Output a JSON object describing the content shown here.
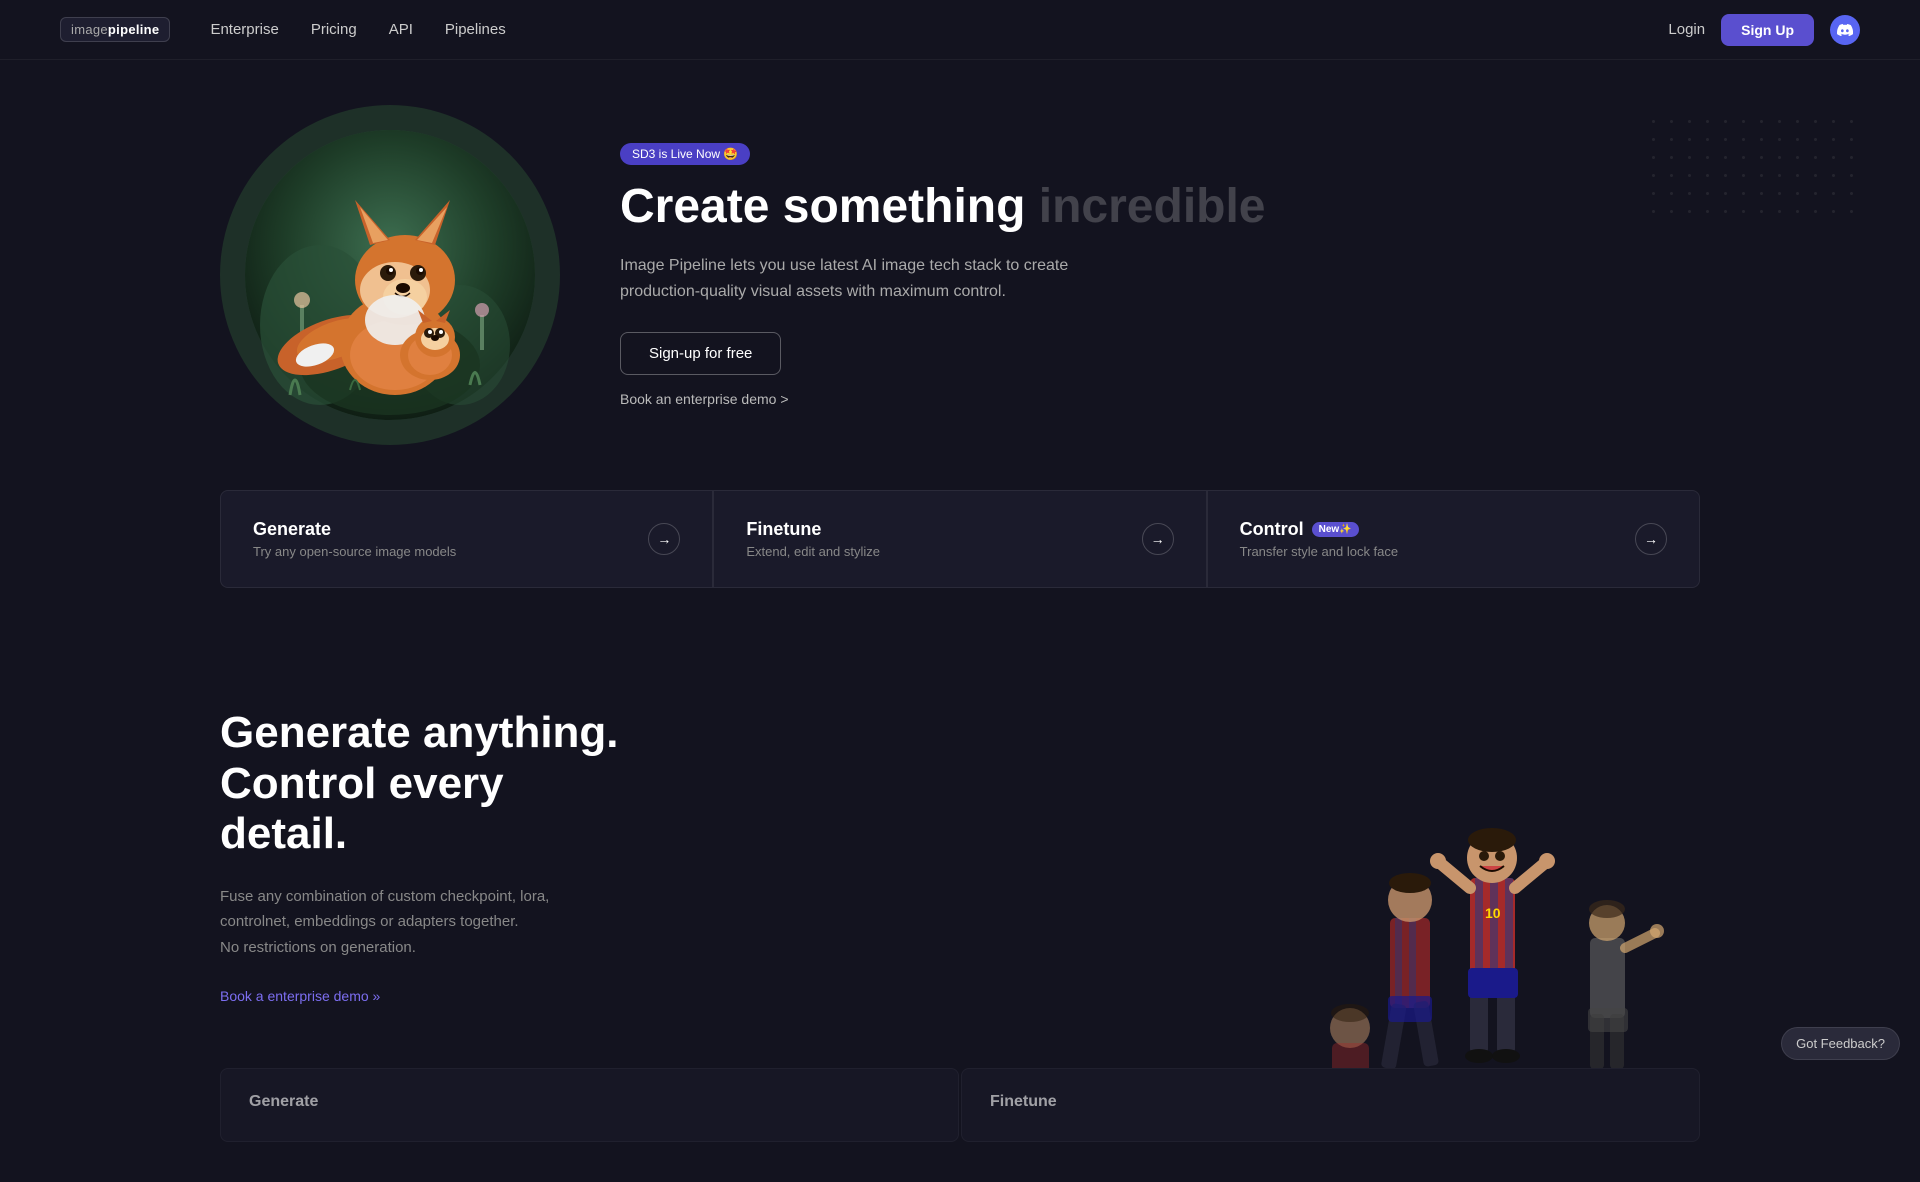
{
  "nav": {
    "logo_text": "image",
    "logo_bold": "pipeline",
    "links": [
      {
        "label": "Enterprise",
        "href": "#"
      },
      {
        "label": "Pricing",
        "href": "#"
      },
      {
        "label": "API",
        "href": "#"
      },
      {
        "label": "Pipelines",
        "href": "#"
      }
    ],
    "login_label": "Login",
    "signup_label": "Sign Up"
  },
  "hero": {
    "badge_text": "SD3 is Live Now 🤩",
    "title_main": "Create something",
    "title_faded": "incredible",
    "subtitle": "Image Pipeline lets you use latest AI image tech stack to create production-quality visual assets with maximum control.",
    "cta_primary": "Sign-up for free",
    "cta_secondary": "Book an enterprise demo >"
  },
  "feature_cards": [
    {
      "title": "Generate",
      "description": "Try any open-source image models",
      "new": false
    },
    {
      "title": "Finetune",
      "description": "Extend, edit and stylize",
      "new": false
    },
    {
      "title": "Control",
      "description": "Transfer style and lock face",
      "new": true,
      "new_label": "New✨"
    }
  ],
  "section2": {
    "title_line1": "Generate anything.",
    "title_line2": "Control every detail.",
    "description": "Fuse any combination of custom checkpoint, lora, controlnet, embeddings or adapters together.\nNo restrictions on generation.",
    "cta": "Book a enterprise demo »"
  },
  "bottom_cards": [
    {
      "title": "Generate",
      "description": "..."
    },
    {
      "title": "Finetune",
      "description": "..."
    }
  ],
  "feedback_label": "Got Feedback?"
}
